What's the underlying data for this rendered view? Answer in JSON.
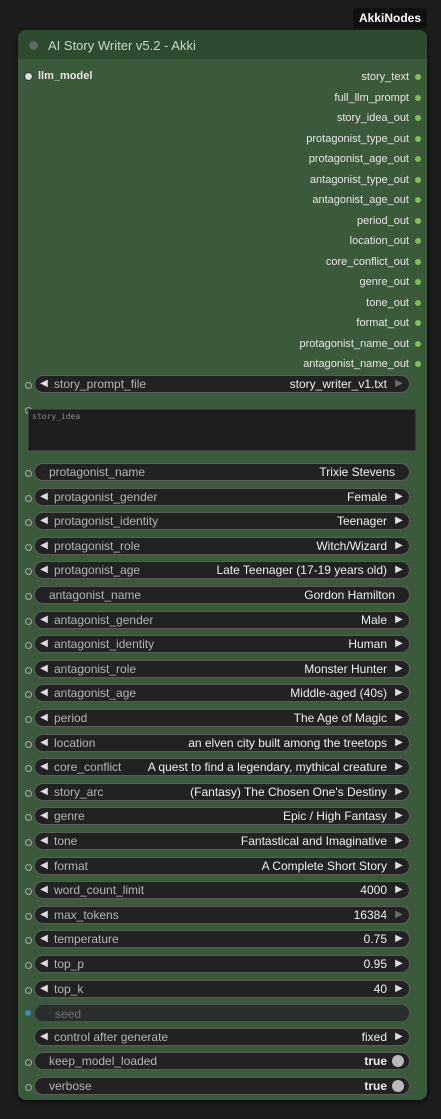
{
  "badge": "AkkiNodes",
  "title": "AI Story Writer v5.2 - Akki",
  "input": "llm_model",
  "outputs": [
    "story_text",
    "full_llm_prompt",
    "story_idea_out",
    "protagonist_type_out",
    "protagonist_age_out",
    "antagonist_type_out",
    "antagonist_age_out",
    "period_out",
    "location_out",
    "core_conflict_out",
    "genre_out",
    "tone_out",
    "format_out",
    "protagonist_name_out",
    "antagonist_name_out"
  ],
  "story_prompt_file": {
    "name": "story_prompt_file",
    "value": "story_writer_v1.txt"
  },
  "story_idea_placeholder": "story_idea",
  "widgets": [
    {
      "name": "protagonist_name",
      "value": "Trixie Stevens",
      "arrows": false
    },
    {
      "name": "protagonist_gender",
      "value": "Female",
      "arrows": true
    },
    {
      "name": "protagonist_identity",
      "value": "Teenager",
      "arrows": true
    },
    {
      "name": "protagonist_role",
      "value": "Witch/Wizard",
      "arrows": true
    },
    {
      "name": "protagonist_age",
      "value": "Late Teenager (17-19 years old)",
      "arrows": true
    },
    {
      "name": "antagonist_name",
      "value": "Gordon Hamilton",
      "arrows": false
    },
    {
      "name": "antagonist_gender",
      "value": "Male",
      "arrows": true
    },
    {
      "name": "antagonist_identity",
      "value": "Human",
      "arrows": true
    },
    {
      "name": "antagonist_role",
      "value": "Monster Hunter",
      "arrows": true
    },
    {
      "name": "antagonist_age",
      "value": "Middle-aged (40s)",
      "arrows": true
    },
    {
      "name": "period",
      "value": "The Age of Magic",
      "arrows": true
    },
    {
      "name": "location",
      "value": "an elven city built among the treetops",
      "arrows": true
    },
    {
      "name": "core_conflict",
      "value": "A quest to find a legendary, mythical creature",
      "arrows": true
    },
    {
      "name": "story_arc",
      "value": "(Fantasy) The Chosen One's Destiny",
      "arrows": true
    },
    {
      "name": "genre",
      "value": "Epic / High Fantasy",
      "arrows": true
    },
    {
      "name": "tone",
      "value": "Fantastical and Imaginative",
      "arrows": true
    },
    {
      "name": "format",
      "value": "A Complete Short Story",
      "arrows": true
    },
    {
      "name": "word_count_limit",
      "value": "4000",
      "arrows": true
    },
    {
      "name": "max_tokens",
      "value": "16384",
      "arrows": true,
      "right_dim": true
    },
    {
      "name": "temperature",
      "value": "0.75",
      "arrows": true
    },
    {
      "name": "top_p",
      "value": "0.95",
      "arrows": true
    },
    {
      "name": "top_k",
      "value": "40",
      "arrows": true
    }
  ],
  "seed": {
    "name": "seed"
  },
  "control_after_generate": {
    "name": "control after generate",
    "value": "fixed"
  },
  "keep_model_loaded": {
    "name": "keep_model_loaded",
    "value": "true"
  },
  "verbose": {
    "name": "verbose",
    "value": "true"
  },
  "colors": {
    "node_body": "#3b5a3b",
    "title_bar": "#2e4a2f",
    "output_dot": "#7ec24a",
    "seed_dot": "#3a86c8"
  }
}
